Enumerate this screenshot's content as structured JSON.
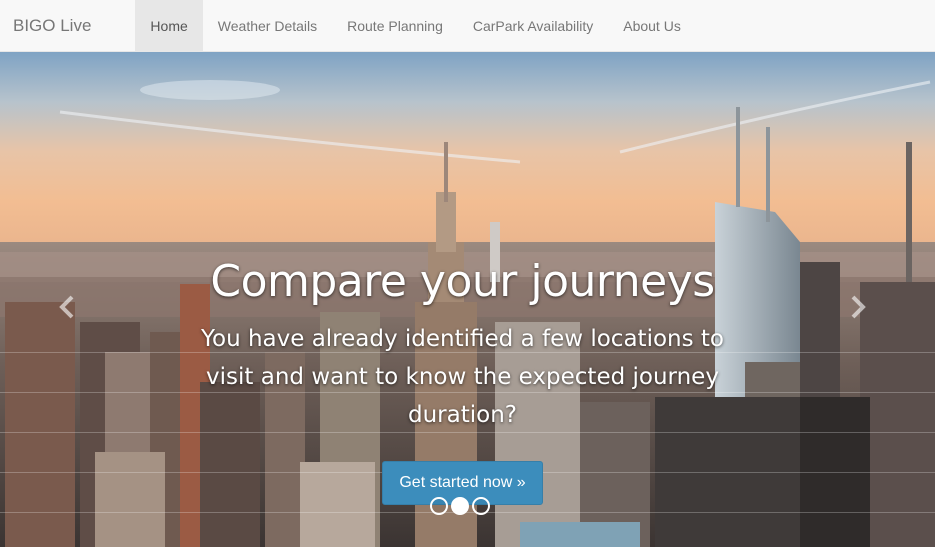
{
  "navbar": {
    "brand": "BIGO Live",
    "items": [
      {
        "label": "Home",
        "active": true
      },
      {
        "label": "Weather Details",
        "active": false
      },
      {
        "label": "Route Planning",
        "active": false
      },
      {
        "label": "CarPark Availability",
        "active": false
      },
      {
        "label": "About Us",
        "active": false
      }
    ]
  },
  "carousel": {
    "background": "city-skyline-sunset-image",
    "slide_count": 3,
    "active_slide": 2,
    "headline": "Compare your journeys",
    "description": "You have already identified a few locations to visit and want to know the expected journey duration?",
    "button_label": "Get started now »",
    "prev_icon": "chevron-left-icon",
    "next_icon": "chevron-right-icon"
  },
  "colors": {
    "accent": "#3c8dbc",
    "navbar_bg": "#f8f8f8",
    "nav_active_bg": "#e7e7e7",
    "nav_text": "#777777"
  }
}
